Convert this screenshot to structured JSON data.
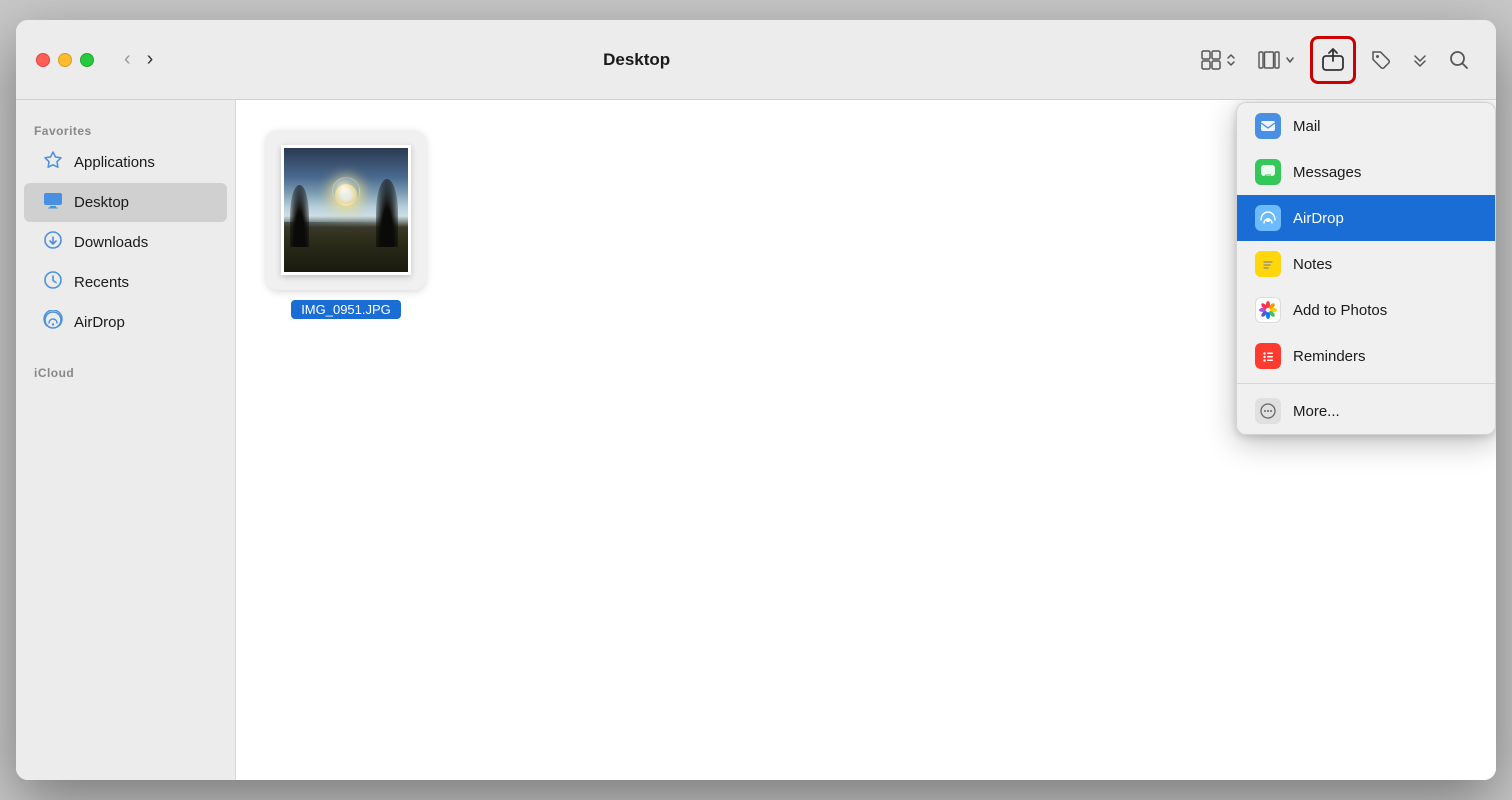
{
  "window": {
    "title": "Desktop"
  },
  "titlebar": {
    "back_label": "‹",
    "forward_label": "›",
    "title": "Desktop"
  },
  "sidebar": {
    "favorites_label": "Favorites",
    "icloud_label": "iCloud",
    "items": [
      {
        "id": "applications",
        "label": "Applications",
        "icon": "🔀",
        "icon_type": "applications",
        "active": false
      },
      {
        "id": "desktop",
        "label": "Desktop",
        "icon": "🖥",
        "icon_type": "desktop",
        "active": true
      },
      {
        "id": "downloads",
        "label": "Downloads",
        "icon": "⬇",
        "icon_type": "downloads",
        "active": false
      },
      {
        "id": "recents",
        "label": "Recents",
        "icon": "🕐",
        "icon_type": "recents",
        "active": false
      },
      {
        "id": "airdrop",
        "label": "AirDrop",
        "icon": "📡",
        "icon_type": "airdrop",
        "active": false
      }
    ]
  },
  "content": {
    "file": {
      "name": "IMG_0951.JPG"
    }
  },
  "share_menu": {
    "items": [
      {
        "id": "mail",
        "label": "Mail",
        "icon_type": "mail",
        "selected": false
      },
      {
        "id": "messages",
        "label": "Messages",
        "icon_type": "messages",
        "selected": false
      },
      {
        "id": "airdrop",
        "label": "AirDrop",
        "icon_type": "airdrop",
        "selected": true
      },
      {
        "id": "notes",
        "label": "Notes",
        "icon_type": "notes",
        "selected": false
      },
      {
        "id": "add-to-photos",
        "label": "Add to Photos",
        "icon_type": "photos",
        "selected": false
      },
      {
        "id": "reminders",
        "label": "Reminders",
        "icon_type": "reminders",
        "selected": false
      },
      {
        "id": "more",
        "label": "More...",
        "icon_type": "more",
        "selected": false
      }
    ]
  },
  "colors": {
    "accent": "#1a6dd4",
    "selected_bg": "#1a6dd4",
    "sidebar_bg": "#ececec",
    "window_bg": "#ffffff",
    "highlight_border": "#cc0000"
  }
}
